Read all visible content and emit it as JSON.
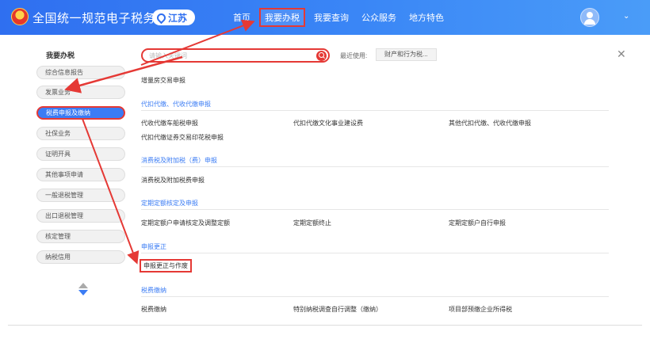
{
  "header": {
    "app_title": "全国统一规范电子税务局",
    "region": "江苏",
    "nav": [
      "首页",
      "我要办税",
      "我要查询",
      "公众服务",
      "地方特色"
    ],
    "user_menu_caret": "⌄"
  },
  "sidebar": {
    "title": "我要办税",
    "items": [
      "综合信息报告",
      "发票业务",
      "税费申报及缴纳",
      "社保业务",
      "证明开具",
      "其他事项申请",
      "一般退税管理",
      "出口退税管理",
      "核定管理",
      "纳税信用"
    ],
    "active_index": 2
  },
  "search": {
    "placeholder": "请输入关键词"
  },
  "recent": {
    "label": "最近使用:",
    "chip": "财产和行为税..."
  },
  "main": {
    "first_item": "增量房交易申报",
    "sections": [
      {
        "title": "代扣代缴、代收代缴申报",
        "items": [
          "代收代缴车船税申报",
          "代扣代缴文化事业建设费",
          "其他代扣代缴、代收代缴申报",
          "代扣代缴证券交易印花税申报"
        ]
      },
      {
        "title": "消费税及附加税（费）申报",
        "items": [
          "消费税及附加税费申报"
        ]
      },
      {
        "title": "定期定额核定及申报",
        "items": [
          "定期定额户申请核定及调整定额",
          "定期定额终止",
          "定期定额户自行申报"
        ]
      },
      {
        "title": "申报更正",
        "items": [
          "申报更正与作废"
        ]
      },
      {
        "title": "税费缴纳",
        "items": [
          "税费缴纳",
          "特别纳税调查自行调整（缴纳）",
          "项目部预缴企业所得税"
        ]
      }
    ]
  },
  "colors": {
    "header": "#2f6ff0",
    "accent": "#3b7cf4",
    "annotation": "#e53935"
  }
}
